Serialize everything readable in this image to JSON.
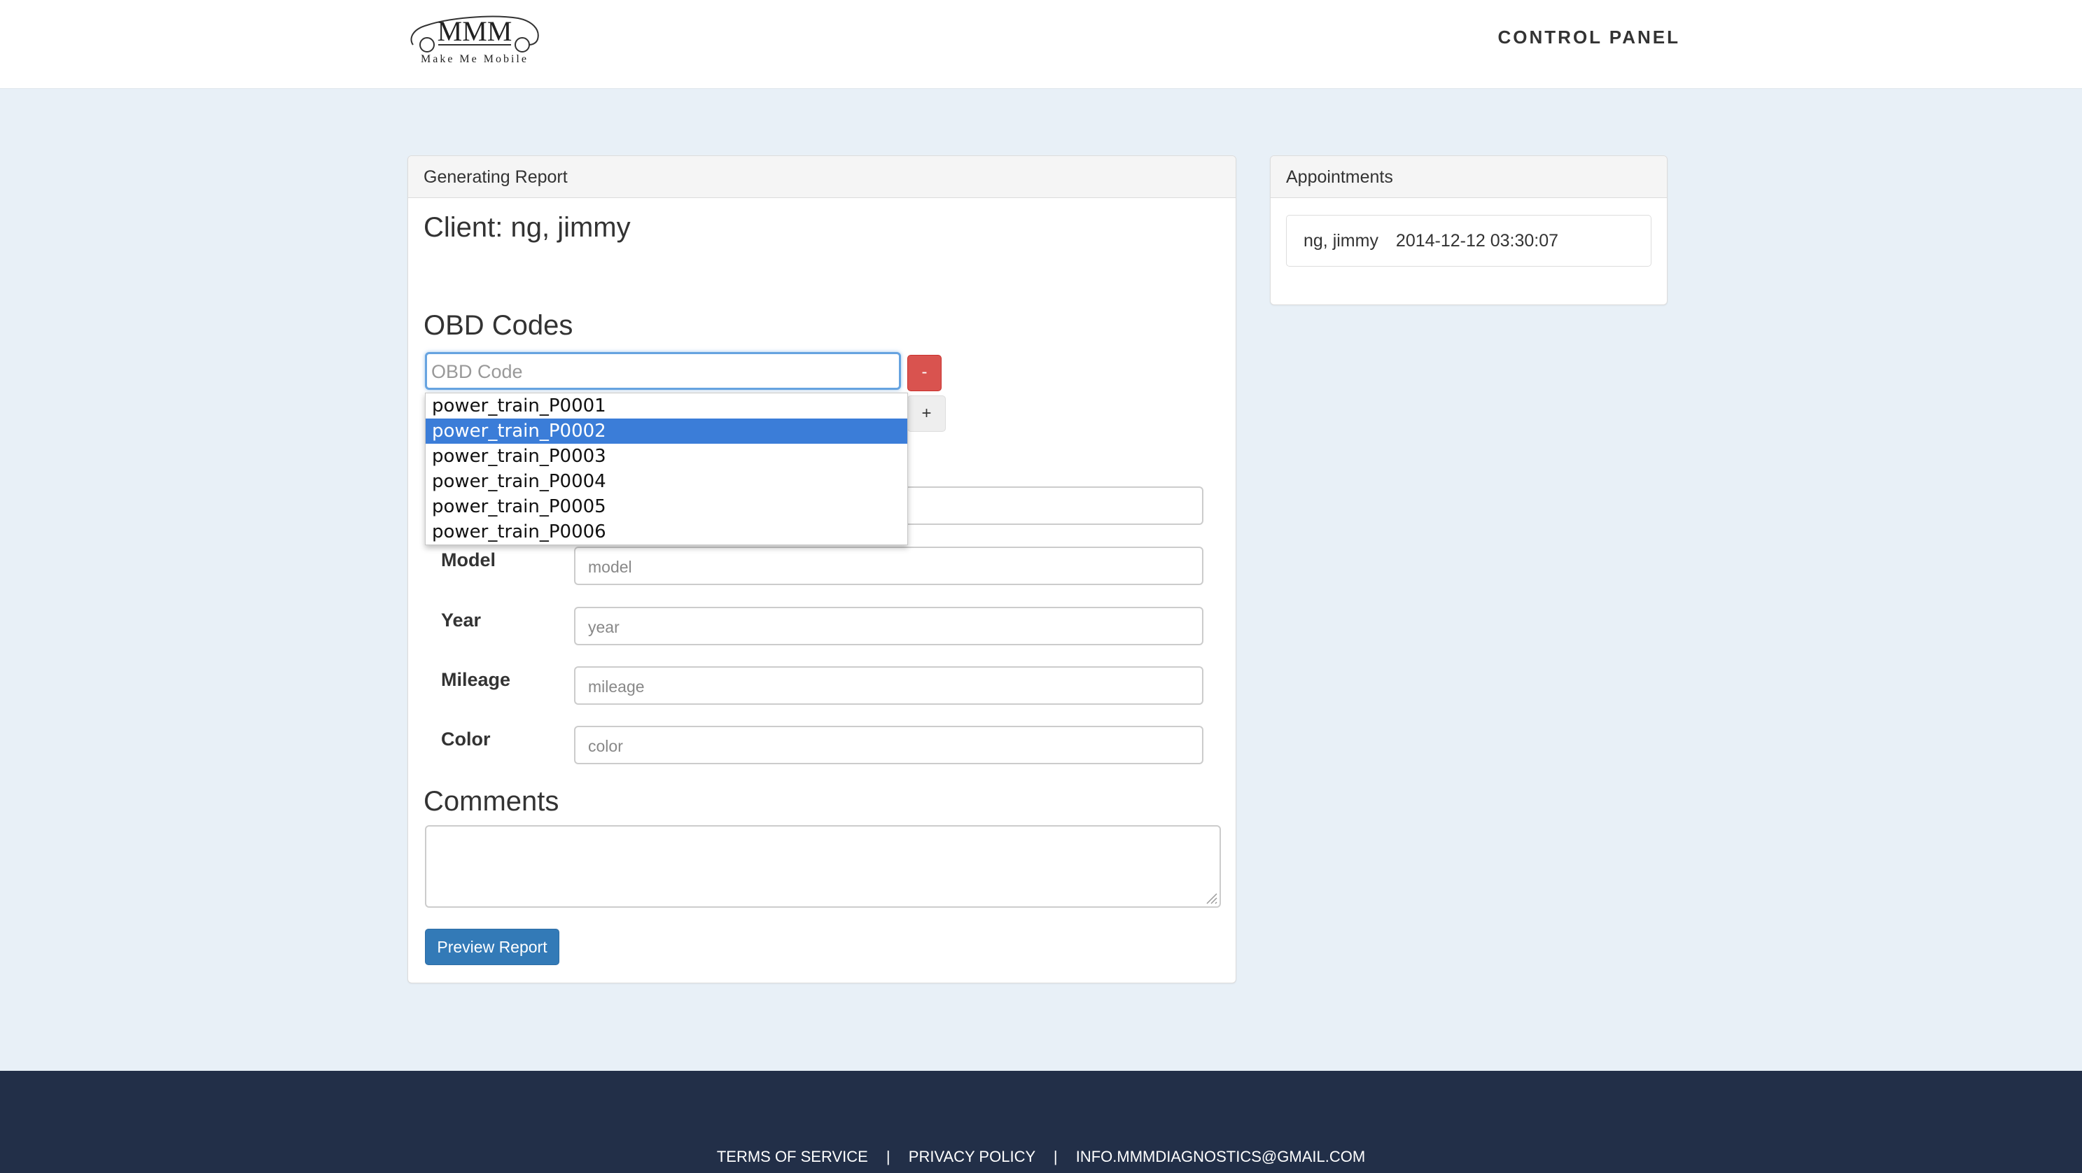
{
  "header": {
    "logo_text": "Make Me Mobile",
    "nav_label": "CONTROL PANEL"
  },
  "main_panel": {
    "heading": "Generating Report",
    "client_label": "Client: ng, jimmy",
    "obd_title": "OBD Codes",
    "obd_input_placeholder": "OBD Code",
    "remove_button": "-",
    "add_button": "+",
    "dropdown_options": [
      {
        "label": "power_train_P0001",
        "selected": false
      },
      {
        "label": "power_train_P0002",
        "selected": true
      },
      {
        "label": "power_train_P0003",
        "selected": false
      },
      {
        "label": "power_train_P0004",
        "selected": false
      },
      {
        "label": "power_train_P0005",
        "selected": false
      },
      {
        "label": "power_train_P0006",
        "selected": false
      }
    ],
    "fields": [
      {
        "label": "Model",
        "placeholder": "model"
      },
      {
        "label": "Year",
        "placeholder": "year"
      },
      {
        "label": "Mileage",
        "placeholder": "mileage"
      },
      {
        "label": "Color",
        "placeholder": "color"
      }
    ],
    "comments_title": "Comments",
    "comments_value": "",
    "preview_button": "Preview Report"
  },
  "appointments_panel": {
    "heading": "Appointments",
    "items": [
      {
        "client": "ng, jimmy",
        "datetime": "2014-12-12 03:30:07"
      }
    ]
  },
  "footer": {
    "links": [
      "TERMS OF SERVICE",
      "PRIVACY POLICY",
      "INFO.MMMDIAGNOSTICS@GMAIL.COM"
    ],
    "separator": "|"
  },
  "colors": {
    "background": "#e8f0f7",
    "footer": "#222f48",
    "danger": "#d9534f",
    "primary": "#337ab7",
    "selected": "#3b7dd8"
  }
}
